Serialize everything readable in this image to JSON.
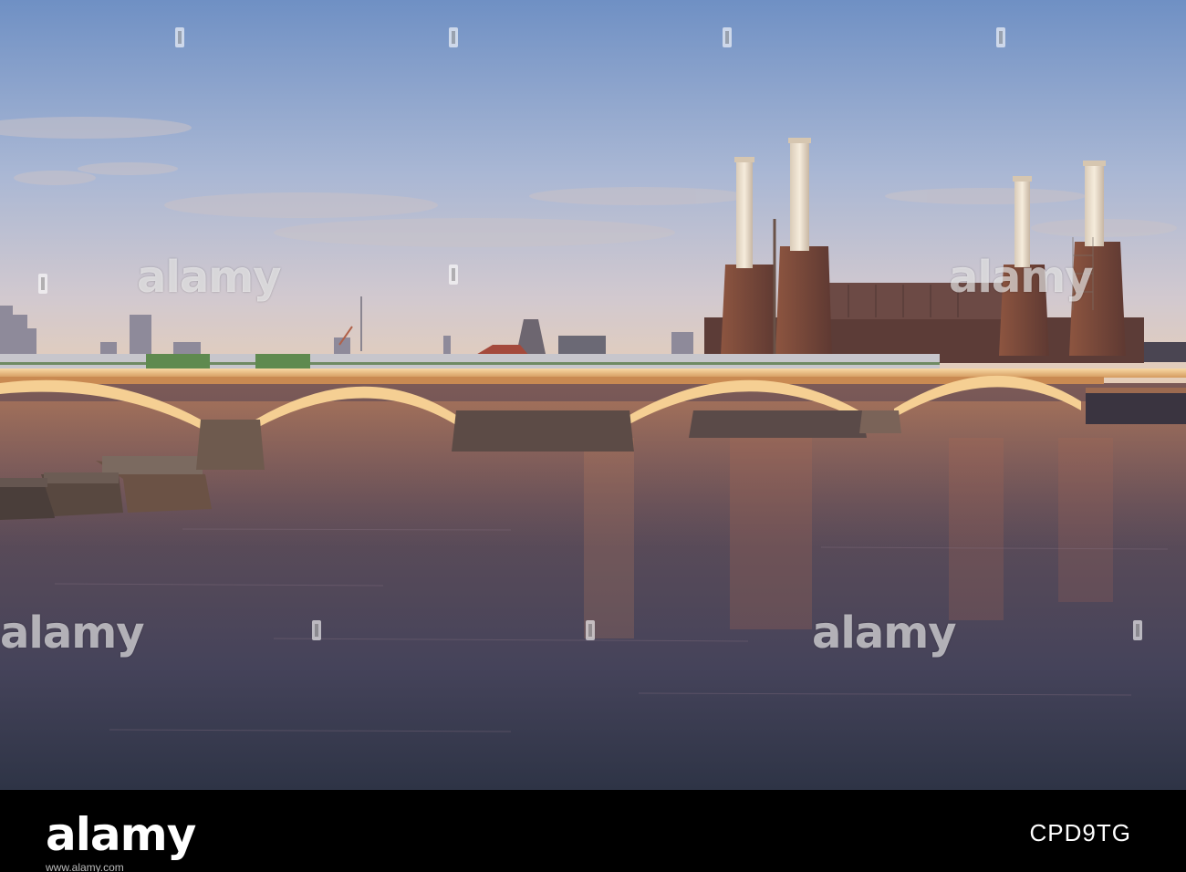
{
  "photo": {
    "subject": "Battersea Power Station and Grosvenor railway bridge over the River Thames",
    "colors": {
      "sky_top": "#6f90c4",
      "sky_mid": "#b6bfd6",
      "sky_horizon": "#e6ceb8",
      "water_top": "#7c5a57",
      "water_mid": "#4f4657",
      "water_bottom": "#2e3446",
      "bridge_gold": "#f3c27c",
      "brick": "#6b4036",
      "chimney": "#efe3d0"
    }
  },
  "watermarks": {
    "label": "alamy",
    "items": [
      {
        "id": "wm-top-left",
        "text": "alamy"
      },
      {
        "id": "wm-top-right",
        "text": "alamy"
      },
      {
        "id": "wm-mid-left",
        "text": "alamy"
      },
      {
        "id": "wm-mid-right",
        "text": "alamy"
      }
    ]
  },
  "footer": {
    "brand": "alamy",
    "stock_id": "CPD9TG",
    "url": "www.alamy.com"
  }
}
